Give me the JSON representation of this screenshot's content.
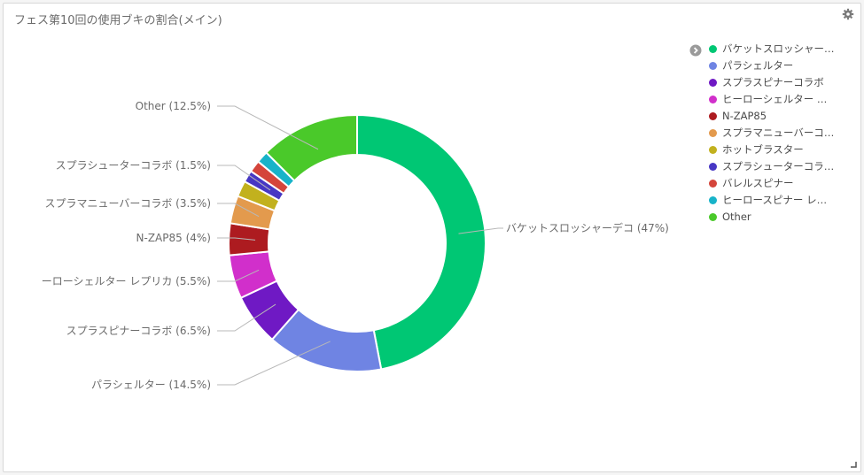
{
  "panel": {
    "title": "フェス第10回の使用ブキの割合(メイン)"
  },
  "icons": {
    "settings": "gear-icon",
    "legend_toggle": "chevron-right-circle-icon",
    "resize": "resize-handle-icon"
  },
  "chart_data": {
    "type": "pie",
    "donut": true,
    "title": "フェス第10回の使用ブキの割合(メイン)",
    "slices": [
      {
        "label": "バケットスロッシャーデコ",
        "legend_label": "バケットスロッシャー…",
        "value": 47,
        "chart_label": "バケットスロッシャーデコ (47%)",
        "color": "#00c774"
      },
      {
        "label": "パラシェルター",
        "legend_label": "パラシェルター",
        "value": 14.5,
        "chart_label": "パラシェルター (14.5%)",
        "color": "#6f84e3"
      },
      {
        "label": "スプラスピナーコラボ",
        "legend_label": "スプラスピナーコラボ",
        "value": 6.5,
        "chart_label": "スプラスピナーコラボ (6.5%)",
        "color": "#6f19c4"
      },
      {
        "label": "ヒーローシェルター レプリカ",
        "legend_label": "ヒーローシェルター …",
        "value": 5.5,
        "chart_label": "ーローシェルター レプリカ (5.5%)",
        "color": "#d12fcb"
      },
      {
        "label": "N-ZAP85",
        "legend_label": "N-ZAP85",
        "value": 4,
        "chart_label": "N-ZAP85 (4%)",
        "color": "#ad1b20"
      },
      {
        "label": "スプラマニューバーコラボ",
        "legend_label": "スプラマニューバーコ…",
        "value": 3.5,
        "chart_label": "スプラマニューバーコラボ (3.5%)",
        "color": "#e39a4d"
      },
      {
        "label": "ホットブラスター",
        "legend_label": "ホットブラスター",
        "value": 2,
        "chart_label": "",
        "color": "#c2b11e"
      },
      {
        "label": "スプラシューターコラボ",
        "legend_label": "スプラシューターコラ…",
        "value": 1.5,
        "chart_label": "スプラシューターコラボ (1.5%)",
        "color": "#4737c4"
      },
      {
        "label": "バレルスピナー",
        "legend_label": "バレルスピナー",
        "value": 1.5,
        "chart_label": "",
        "color": "#d4453b"
      },
      {
        "label": "ヒーロースピナー レプリカ",
        "legend_label": "ヒーロースピナー レ…",
        "value": 1.5,
        "chart_label": "",
        "color": "#17b3c9"
      },
      {
        "label": "Other",
        "legend_label": "Other",
        "value": 12.5,
        "chart_label": "Other (12.5%)",
        "color": "#4ac92a"
      }
    ],
    "legend_position": "right"
  }
}
